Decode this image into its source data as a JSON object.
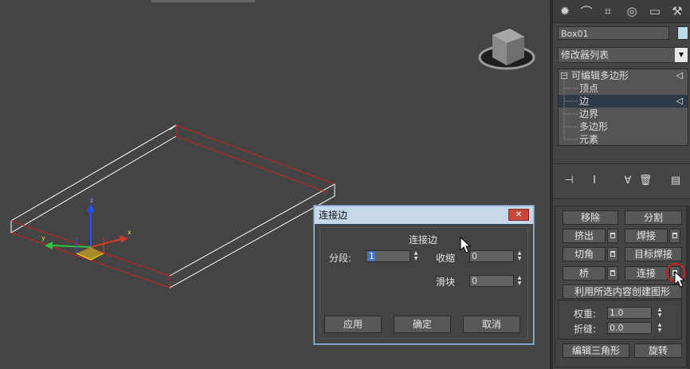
{
  "command_panel": {
    "tabs": [
      {
        "icon": "sun-icon",
        "glyph": "✹"
      },
      {
        "icon": "modify-curve-icon",
        "glyph": "⌒"
      },
      {
        "icon": "hierarchy-icon",
        "glyph": "⌗"
      },
      {
        "icon": "motion-icon",
        "glyph": "◎"
      },
      {
        "icon": "display-icon",
        "glyph": "▭"
      },
      {
        "icon": "utilities-hammer-icon",
        "glyph": "⚒"
      }
    ],
    "object_name": "Box01",
    "object_color": "#b9dcec",
    "modifier_list": "修改器列表",
    "stack": {
      "root": "可编辑多边形",
      "subobjects": [
        "顶点",
        "边",
        "边界",
        "多边形",
        "元素"
      ],
      "selected": "边"
    },
    "stack_tools": [
      {
        "icon": "pin-stack-icon",
        "glyph": "⊣"
      },
      {
        "icon": "show-end-result-icon",
        "glyph": "Ⅰ"
      },
      {
        "icon": "make-unique-icon",
        "glyph": "∀"
      },
      {
        "icon": "remove-modifier-icon",
        "glyph": "🗑"
      },
      {
        "icon": "configure-modifier-sets-icon",
        "glyph": "▤"
      }
    ],
    "edit_edges": {
      "remove": "移除",
      "split": "分割",
      "extrude": "挤出",
      "weld": "焊接",
      "chamfer": "切角",
      "target_weld": "目标焊接",
      "bridge": "桥",
      "connect": "连接",
      "create_shape": "利用所选内容创建图形",
      "weight_label": "权重:",
      "weight_value": "1.0",
      "crease_label": "折缝:",
      "crease_value": "0.0",
      "edit_tri": "编辑三角形",
      "turn": "旋转"
    }
  },
  "dialog": {
    "title": "连接边",
    "heading": "连接边",
    "segments_label": "分段:",
    "segments_value": "1",
    "pinch_label": "收缩",
    "pinch_value": "0",
    "slide_label": "滑块",
    "slide_value": "0",
    "apply": "应用",
    "ok": "确定",
    "cancel": "取消"
  },
  "gizmo": {
    "x": "x",
    "y": "y",
    "z": "z"
  }
}
